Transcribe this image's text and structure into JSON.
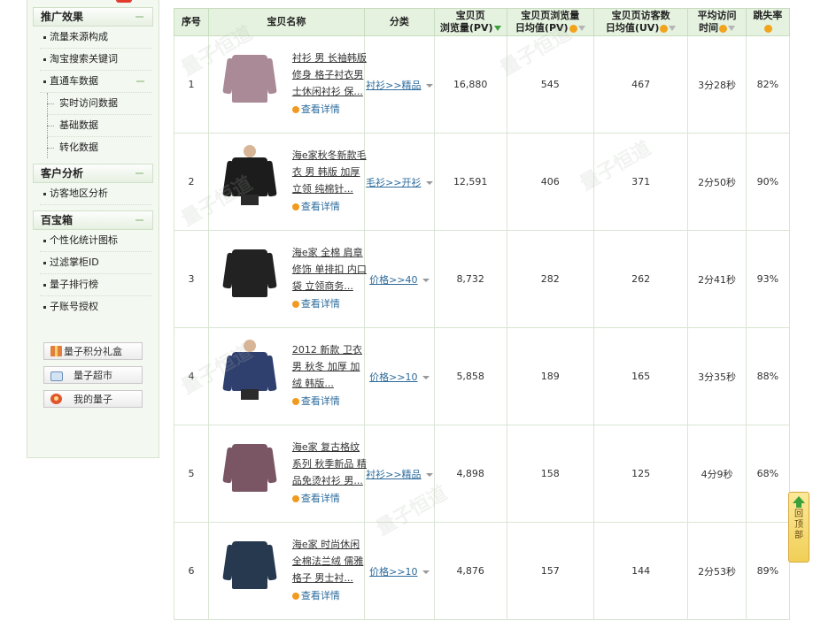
{
  "sidebar": {
    "section_promo": {
      "title": "推广效果"
    },
    "promo_items": [
      "流量来源构成",
      "淘宝搜索关键词",
      "直通车数据"
    ],
    "ztc_sub": [
      "实时访问数据",
      "基础数据",
      "转化数据"
    ],
    "section_customer": {
      "title": "客户分析"
    },
    "customer_items": [
      "访客地区分析"
    ],
    "section_toolbox": {
      "title": "百宝箱"
    },
    "toolbox_items": [
      "个性化统计图标",
      "过滤掌柜ID",
      "量子排行榜",
      "子账号授权"
    ],
    "buttons": [
      {
        "label": "量子积分礼盒",
        "icon": "gift-icon"
      },
      {
        "label": "量子超市",
        "icon": "cart-icon"
      },
      {
        "label": "我的量子",
        "icon": "user-icon"
      }
    ]
  },
  "table": {
    "headers": {
      "index": "序号",
      "name": "宝贝名称",
      "category": "分类",
      "pv_line1": "宝贝页",
      "pv_line2": "浏览量(PV)",
      "avg_pv_line1": "宝贝页浏览量",
      "avg_pv_line2": "日均值(PV)",
      "avg_uv_line1": "宝贝页访客数",
      "avg_uv_line2": "日均值(UV)",
      "time_line1": "平均访问",
      "time_line2": "时间",
      "bounce": "跳失率"
    },
    "detail_label": "查看详情",
    "rows": [
      {
        "index": "1",
        "title": "衬衫 男 长袖韩版 修身 格子衬衣男士休闲衬衫 保...",
        "category": "衬衫>>精品",
        "pv": "16,880",
        "avg_pv": "545",
        "avg_uv": "467",
        "time": "3分28秒",
        "bounce": "82%",
        "garment_color": "#a98a96",
        "model": false
      },
      {
        "index": "2",
        "title": "海e家秋冬新款毛衣 男 韩版 加厚立领 纯棉针...",
        "category": "毛衫>>开衫",
        "pv": "12,591",
        "avg_pv": "406",
        "avg_uv": "371",
        "time": "2分50秒",
        "bounce": "90%",
        "garment_color": "#1c1c1c",
        "model": true
      },
      {
        "index": "3",
        "title": "海e家 全棉 肩章修饰 单排扣 内口袋 立领商务...",
        "category": "价格>>40",
        "pv": "8,732",
        "avg_pv": "282",
        "avg_uv": "262",
        "time": "2分41秒",
        "bounce": "93%",
        "garment_color": "#222222",
        "model": false
      },
      {
        "index": "4",
        "title": "2012 新款 卫衣 男 秋冬 加厚 加绒 韩版...",
        "category": "价格>>10",
        "pv": "5,858",
        "avg_pv": "189",
        "avg_uv": "165",
        "time": "3分35秒",
        "bounce": "88%",
        "garment_color": "#2f3f6e",
        "model": true
      },
      {
        "index": "5",
        "title": "海e家 复古格纹系列 秋季新品 精品免烫衬衫 男...",
        "category": "衬衫>>精品",
        "pv": "4,898",
        "avg_pv": "158",
        "avg_uv": "125",
        "time": "4分9秒",
        "bounce": "68%",
        "garment_color": "#7a5563",
        "model": false
      },
      {
        "index": "6",
        "title": "海e家 时尚休闲 全棉法兰绒 儒雅格子 男士衬...",
        "category": "价格>>10",
        "pv": "4,876",
        "avg_pv": "157",
        "avg_uv": "144",
        "time": "2分53秒",
        "bounce": "89%",
        "garment_color": "#27394f",
        "model": false
      }
    ]
  },
  "watermark": "量子恒道",
  "back_to_top": "回顶部"
}
